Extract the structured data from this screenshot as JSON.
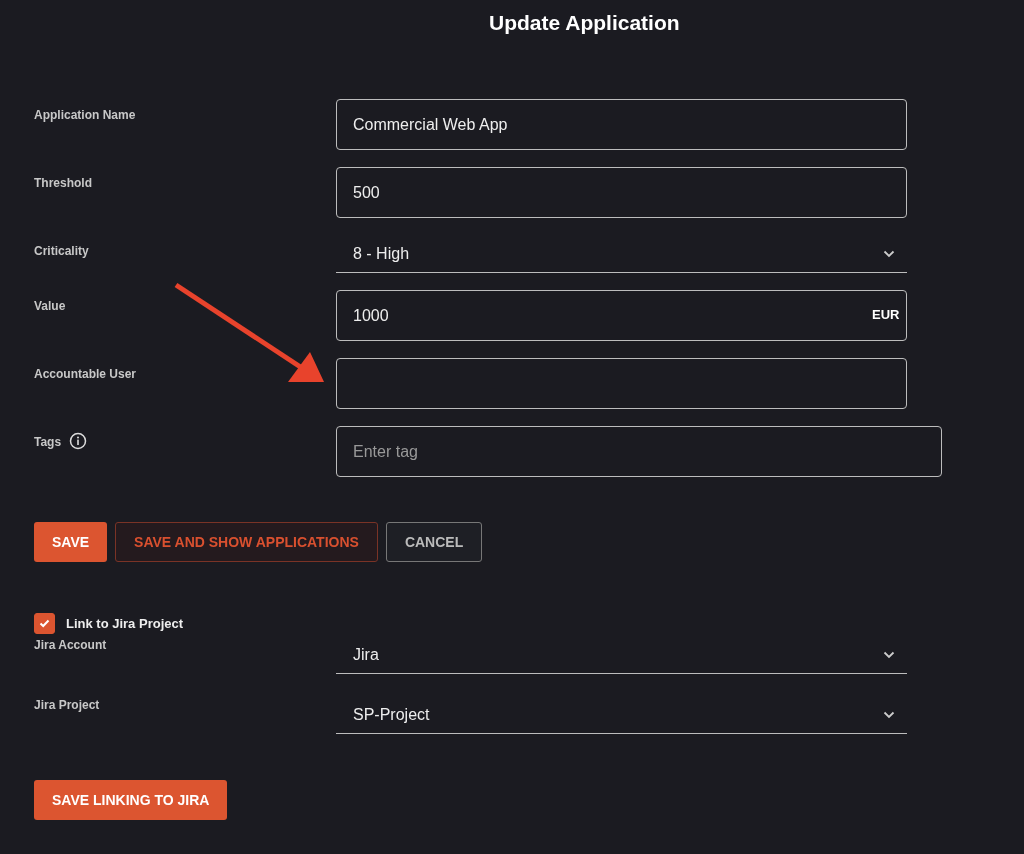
{
  "title": "Update Application",
  "fields": [
    {
      "label": "Application Name",
      "kind": "text",
      "value": "Commercial Web App"
    },
    {
      "label": "Threshold",
      "kind": "text",
      "value": "500"
    },
    {
      "label": "Criticality",
      "kind": "select",
      "value": "8 - High"
    },
    {
      "label": "Value",
      "kind": "text",
      "value": "1000",
      "suffix": "EUR"
    },
    {
      "label": "Accountable User",
      "kind": "text"
    },
    {
      "label": "Tags",
      "kind": "tags",
      "placeholder": "Enter tag",
      "info": true
    }
  ],
  "buttons": [
    {
      "label": "SAVE",
      "kind": "primary"
    },
    {
      "label": "SAVE AND SHOW APPLICATIONS",
      "kind": "danger-outline"
    },
    {
      "label": "CANCEL",
      "kind": "outline"
    }
  ],
  "jira": {
    "checkbox": {
      "label": "Link to Jira Project",
      "checked": true
    },
    "fields": [
      {
        "label": "Jira Account",
        "kind": "select",
        "value": "Jira"
      },
      {
        "label": "Jira Project",
        "kind": "select",
        "value": "SP-Project"
      }
    ],
    "button": {
      "label": "SAVE LINKING TO JIRA",
      "kind": "primary"
    }
  }
}
